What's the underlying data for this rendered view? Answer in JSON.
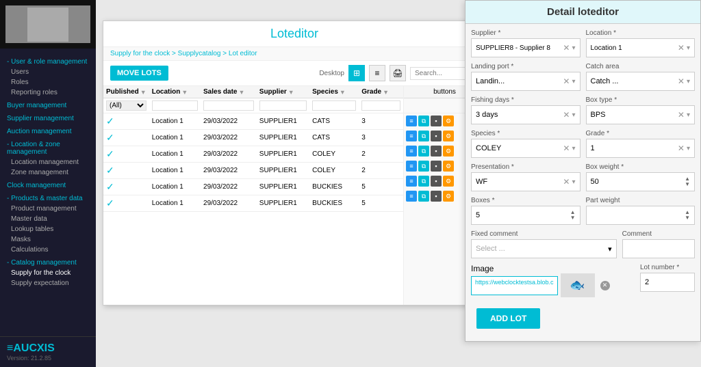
{
  "sidebar": {
    "sections": [
      {
        "label": "User & role management",
        "items": [
          "Users",
          "Roles",
          "Reporting roles"
        ]
      },
      {
        "label": "Buyer management",
        "items": []
      },
      {
        "label": "Supplier management",
        "items": []
      },
      {
        "label": "Auction management",
        "items": []
      },
      {
        "label": "Location & zone management",
        "items": [
          "Location management",
          "Zone management"
        ]
      },
      {
        "label": "Clock management",
        "items": []
      },
      {
        "label": "Products & master data",
        "items": [
          "Product management",
          "Master data",
          "Lookup tables",
          "Masks",
          "Calculations"
        ]
      },
      {
        "label": "Catalog management",
        "items": [
          "Supply for the clock",
          "Supply expectation"
        ]
      }
    ],
    "brand": "≡AUCXIS",
    "version": "Version: 21.2.85"
  },
  "loteditor": {
    "title": "Loteditor",
    "breadcrumb": "Supply for the clock > Supplycatalog > Lot editor",
    "move_lots_btn": "MOVE LOTS",
    "desktop_label": "Desktop",
    "table": {
      "columns": [
        "Published",
        "Location",
        "Sales date",
        "Supplier",
        "Species",
        "Grade"
      ],
      "filter_all": "(All)",
      "rows": [
        {
          "published": true,
          "location": "Location 1",
          "sales_date": "29/03/2022",
          "supplier": "SUPPLIER1",
          "species": "CATS",
          "grade": "3"
        },
        {
          "published": true,
          "location": "Location 1",
          "sales_date": "29/03/2022",
          "supplier": "SUPPLIER1",
          "species": "CATS",
          "grade": "3"
        },
        {
          "published": true,
          "location": "Location 1",
          "sales_date": "29/03/2022",
          "supplier": "SUPPLIER1",
          "species": "COLEY",
          "grade": "2"
        },
        {
          "published": true,
          "location": "Location 1",
          "sales_date": "29/03/2022",
          "supplier": "SUPPLIER1",
          "species": "COLEY",
          "grade": "2"
        },
        {
          "published": true,
          "location": "Location 1",
          "sales_date": "29/03/2022",
          "supplier": "SUPPLIER1",
          "species": "BUCKIES",
          "grade": "5"
        },
        {
          "published": true,
          "location": "Location 1",
          "sales_date": "29/03/2022",
          "supplier": "SUPPLIER1",
          "species": "BUCKIES",
          "grade": "5"
        }
      ]
    }
  },
  "right_small_panel": {
    "supplier_label": "Supplier *",
    "supplier_value": "SUPPLIER8 - Supplier 8",
    "landing_port_label": "Landing port *",
    "landing_port_value": "Landin...",
    "catch_area_label": "Catch area",
    "catch_area_value": "Catch ...",
    "fishing_days_label": "Fishing days *",
    "fishing_days_value": "3 days",
    "box_type_label": "Box type",
    "box_type_value": "BPS",
    "species_label": "Species *",
    "species_value": "COLEY",
    "grade_label": "Gra...",
    "grade_value": "1",
    "presentation_label": "Presentation *",
    "presentation_value": "WF",
    "boxes_label": "Boxes *",
    "boxes_value": "5",
    "part_weight_label": "Part weigh...",
    "fixed_comment_label": "Fixed comment",
    "fixed_comment_placeholder": "Select ...",
    "image_label": "Image",
    "image_url": "https://webclocktestsa.blob...",
    "add_lot_btn": "ADD LOT"
  },
  "detail_panel": {
    "title": "Detail loteditor",
    "supplier_label": "Supplier *",
    "supplier_value": "SUPPLIER8 - Supplier 8",
    "location_label": "Location *",
    "location_value": "Location 1",
    "landing_port_label": "Landing port *",
    "landing_port_value": "Landin...",
    "catch_area_label": "Catch area",
    "catch_area_value": "Catch ...",
    "fishing_days_label": "Fishing days *",
    "fishing_days_value": "3 days",
    "box_type_label": "Box type *",
    "box_type_value": "BPS",
    "species_label": "Species *",
    "species_value": "COLEY",
    "grade_label": "Grade *",
    "grade_value": "1",
    "presentation_label": "Presentation *",
    "presentation_value": "WF",
    "box_weight_label": "Box weight *",
    "box_weight_value": "50",
    "boxes_label": "Boxes *",
    "boxes_value": "5",
    "part_weight_label": "Part weight",
    "fixed_comment_label": "Fixed comment",
    "fixed_comment_placeholder": "Select ...",
    "comment_label": "Comment",
    "image_label": "Image",
    "image_url": "https://webclocktestsa.blob.c",
    "lot_number_label": "Lot number *",
    "lot_number_value": "2",
    "add_lot_btn": "ADD LOT"
  }
}
